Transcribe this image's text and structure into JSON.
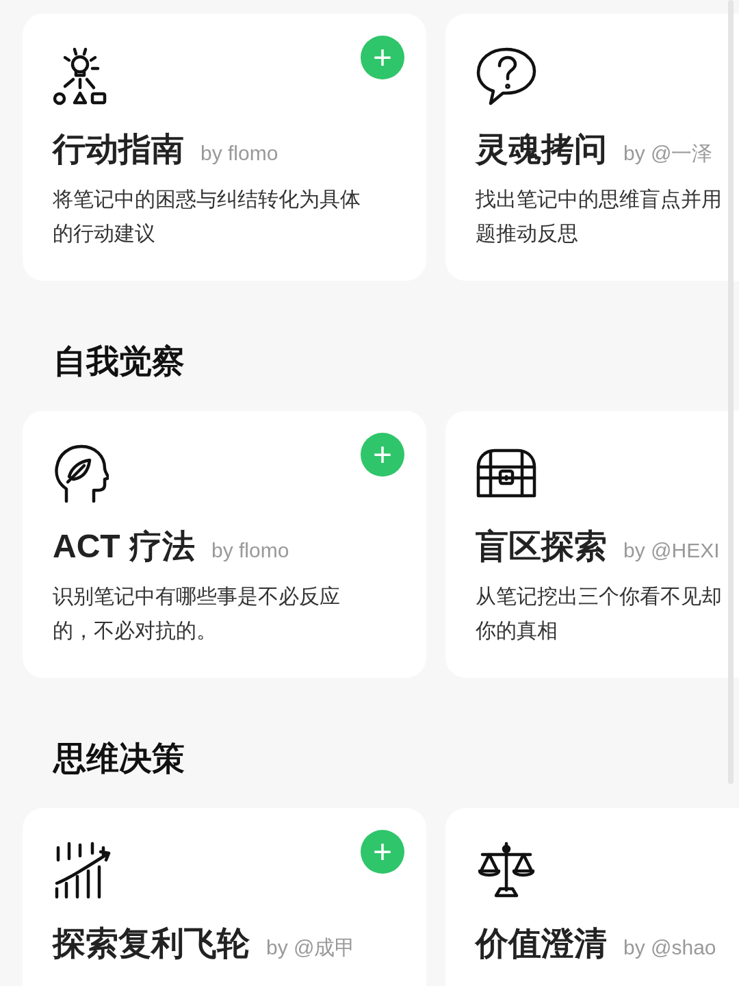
{
  "sections": [
    {
      "cards": [
        {
          "title": "行动指南",
          "author": "by flomo",
          "description": [
            "将笔记中的困惑与纠结转化为具体",
            "的行动建议"
          ],
          "add_button": "+"
        },
        {
          "title": "灵魂拷问",
          "author": "by @一泽",
          "description": [
            "找出笔记中的思维盲点并用",
            "题推动反思"
          ]
        }
      ]
    },
    {
      "title": "自我觉察",
      "cards": [
        {
          "title": "ACT 疗法",
          "author": "by flomo",
          "description": [
            "识别笔记中有哪些事是不必反应",
            "的，不必对抗的。"
          ],
          "add_button": "+"
        },
        {
          "title": "盲区探索",
          "author": "by @HEXI",
          "description": [
            "从笔记挖出三个你看不见却",
            "你的真相"
          ]
        }
      ]
    },
    {
      "title": "思维决策",
      "cards": [
        {
          "title": "探索复利飞轮",
          "author": "by @成甲",
          "add_button": "+"
        },
        {
          "title": "价值澄清",
          "author": "by @shao"
        }
      ]
    }
  ]
}
